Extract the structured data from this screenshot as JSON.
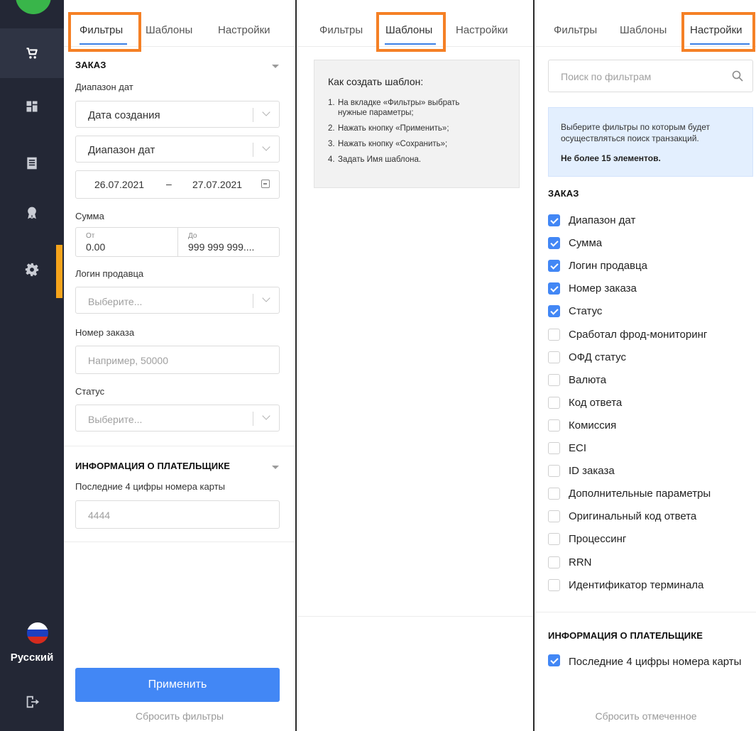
{
  "colors": {
    "sidebar_bg": "#232735",
    "accent": "#4287f5",
    "highlight": "#f58025",
    "active_indicator": "#f6a41b"
  },
  "sidebar": {
    "items": [
      {
        "icon": "cart-icon",
        "active": true
      },
      {
        "icon": "dashboard-icon",
        "active": false
      },
      {
        "icon": "list-icon",
        "active": false
      },
      {
        "icon": "award-icon",
        "active": false
      },
      {
        "icon": "gear-icon",
        "active": false
      }
    ],
    "language": "Русский",
    "exit_icon": "logout-icon"
  },
  "tabs": {
    "filters": "Фильтры",
    "templates": "Шаблоны",
    "settings": "Настройки"
  },
  "filters_panel": {
    "order_section": "ЗАКАЗ",
    "date_range_label": "Диапазон дат",
    "date_type_value": "Дата создания",
    "date_range_value": "Диапазон дат",
    "date_from": "26.07.2021",
    "date_dash": "–",
    "date_to": "27.07.2021",
    "sum_label": "Сумма",
    "sum_from_caption": "От",
    "sum_from_value": "0.00",
    "sum_to_caption": "До",
    "sum_to_value": "999 999 999....",
    "seller_login_label": "Логин продавца",
    "seller_login_placeholder": "Выберите...",
    "order_number_label": "Номер заказа",
    "order_number_placeholder": "Например, 50000",
    "status_label": "Статус",
    "status_placeholder": "Выберите...",
    "payer_section": "ИНФОРМАЦИЯ О ПЛАТЕЛЬЩИКЕ",
    "card_last4_label": "Последние 4 цифры номера карты",
    "card_last4_placeholder": "4444",
    "apply_button": "Применить",
    "reset_link": "Сбросить фильтры"
  },
  "templates_panel": {
    "title": "Как создать шаблон:",
    "steps": [
      {
        "num": "1.",
        "line1": "На вкладке «Фильтры» выбрать",
        "line2": "нужные параметры;"
      },
      {
        "num": "2.",
        "line1": "Нажать кнопку «Применить»;"
      },
      {
        "num": "3.",
        "line1": "Нажать кнопку «Сохранить»;"
      },
      {
        "num": "4.",
        "line1": "Задать Имя шаблона."
      }
    ]
  },
  "settings_panel": {
    "search_placeholder": "Поиск по фильтрам",
    "info_text": "Выберите фильтры по которым будет осуществляться поиск транзакций.",
    "info_limit": "Не более 15 элементов.",
    "order_section": "ЗАКАЗ",
    "order_filters": [
      {
        "label": "Диапазон дат",
        "checked": true
      },
      {
        "label": "Сумма",
        "checked": true
      },
      {
        "label": "Логин продавца",
        "checked": true
      },
      {
        "label": "Номер заказа",
        "checked": true
      },
      {
        "label": "Статус",
        "checked": true
      },
      {
        "label": "Сработал фрод-мониторинг",
        "checked": false
      },
      {
        "label": "ОФД статус",
        "checked": false
      },
      {
        "label": "Валюта",
        "checked": false
      },
      {
        "label": "Код ответа",
        "checked": false
      },
      {
        "label": "Комиссия",
        "checked": false
      },
      {
        "label": "ECI",
        "checked": false
      },
      {
        "label": "ID заказа",
        "checked": false
      },
      {
        "label": "Дополнительные параметры",
        "checked": false
      },
      {
        "label": "Оригинальный код ответа",
        "checked": false
      },
      {
        "label": "Процессинг",
        "checked": false
      },
      {
        "label": "RRN",
        "checked": false
      },
      {
        "label": "Идентификатор терминала",
        "checked": false
      }
    ],
    "payer_section": "ИНФОРМАЦИЯ О ПЛАТЕЛЬЩИКЕ",
    "payer_filters": [
      {
        "label": "Последние 4 цифры номера карты",
        "checked": true
      }
    ],
    "reset_link": "Сбросить отмеченное"
  }
}
